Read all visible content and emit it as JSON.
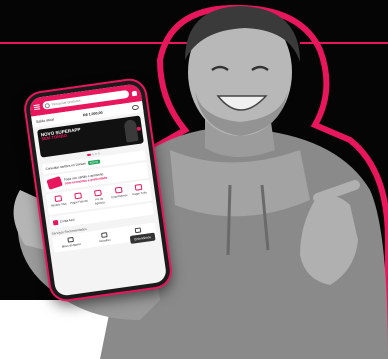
{
  "colors": {
    "accent": "#e8175d",
    "panel": "#050505"
  },
  "app": {
    "search_placeholder": "Pesquisar produtos",
    "balance_label": "Saldo atual",
    "balance_value": "R$ 1.000,00",
    "banner_title": "NOVO SUPERAPP",
    "banner_subtitle": "SEM TOMBO",
    "card_text": "Consultar cartões no Dorsan",
    "card_badge": "NOVO",
    "promo_text": "Faça seu cartão e aproveite",
    "promo_strong": "com economia e praticidade",
    "grid": [
      {
        "label": "Modelo Visa",
        "icon": "card-icon"
      },
      {
        "label": "Pagar Faturas",
        "icon": "bill-icon"
      },
      {
        "label": "Pix da Agência",
        "icon": "pix-icon"
      },
      {
        "label": "Empréstimos",
        "icon": "loan-icon"
      },
      {
        "label": "Pagar Tudo",
        "icon": "pay-icon"
      }
    ],
    "invest_label": "Conta Azul",
    "tooltip": "Entendimos",
    "section_label": "Serviços Recomendados",
    "nav": [
      {
        "label": "Meus do Banco",
        "icon": "bank-icon"
      },
      {
        "label": "Recolher",
        "icon": "collect-icon"
      },
      {
        "label": "Promoções",
        "icon": "promo-icon"
      }
    ]
  }
}
